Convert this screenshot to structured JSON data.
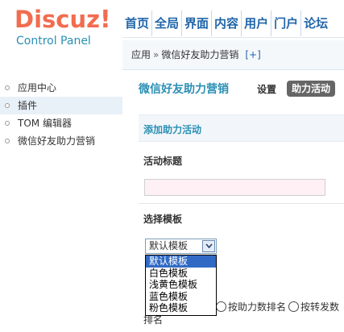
{
  "logo": {
    "title": "Discuz",
    "mark": "!",
    "subtitle": "Control Panel"
  },
  "topnav": [
    "首页",
    "全局",
    "界面",
    "内容",
    "用户",
    "门户",
    "论坛"
  ],
  "breadcrumb": {
    "root": "应用",
    "separator": "»",
    "current": "微信好友助力营销",
    "add": "[+]"
  },
  "sidebar": {
    "items": [
      {
        "label": "应用中心",
        "active": false
      },
      {
        "label": "插件",
        "active": true
      },
      {
        "label": "TOM 编辑器",
        "active": false
      },
      {
        "label": "微信好友助力营销",
        "active": false
      }
    ]
  },
  "main": {
    "title": "微信好友助力营销",
    "tabs": {
      "setting": "设置",
      "active": "助力活动"
    },
    "section_title": "添加助力活动",
    "activity_title_label": "活动标题",
    "activity_title_value": "",
    "template_label": "选择模板",
    "template_select": {
      "value": "默认模板",
      "options": [
        "默认模板",
        "白色模板",
        "浅黄色模板",
        "蓝色模板",
        "粉色模板"
      ],
      "highlighted": "默认模板"
    },
    "sort_options": [
      "按助力数排名",
      "按转发数"
    ],
    "sort_label": "排名"
  },
  "colors": {
    "logo_red": "#f26c4f",
    "brand_blue": "#2b8fb4",
    "nav_blue": "#2266aa",
    "tab_active_bg": "#666666",
    "select_highlight": "#316ac5",
    "input_bg": "#fff0f5"
  }
}
